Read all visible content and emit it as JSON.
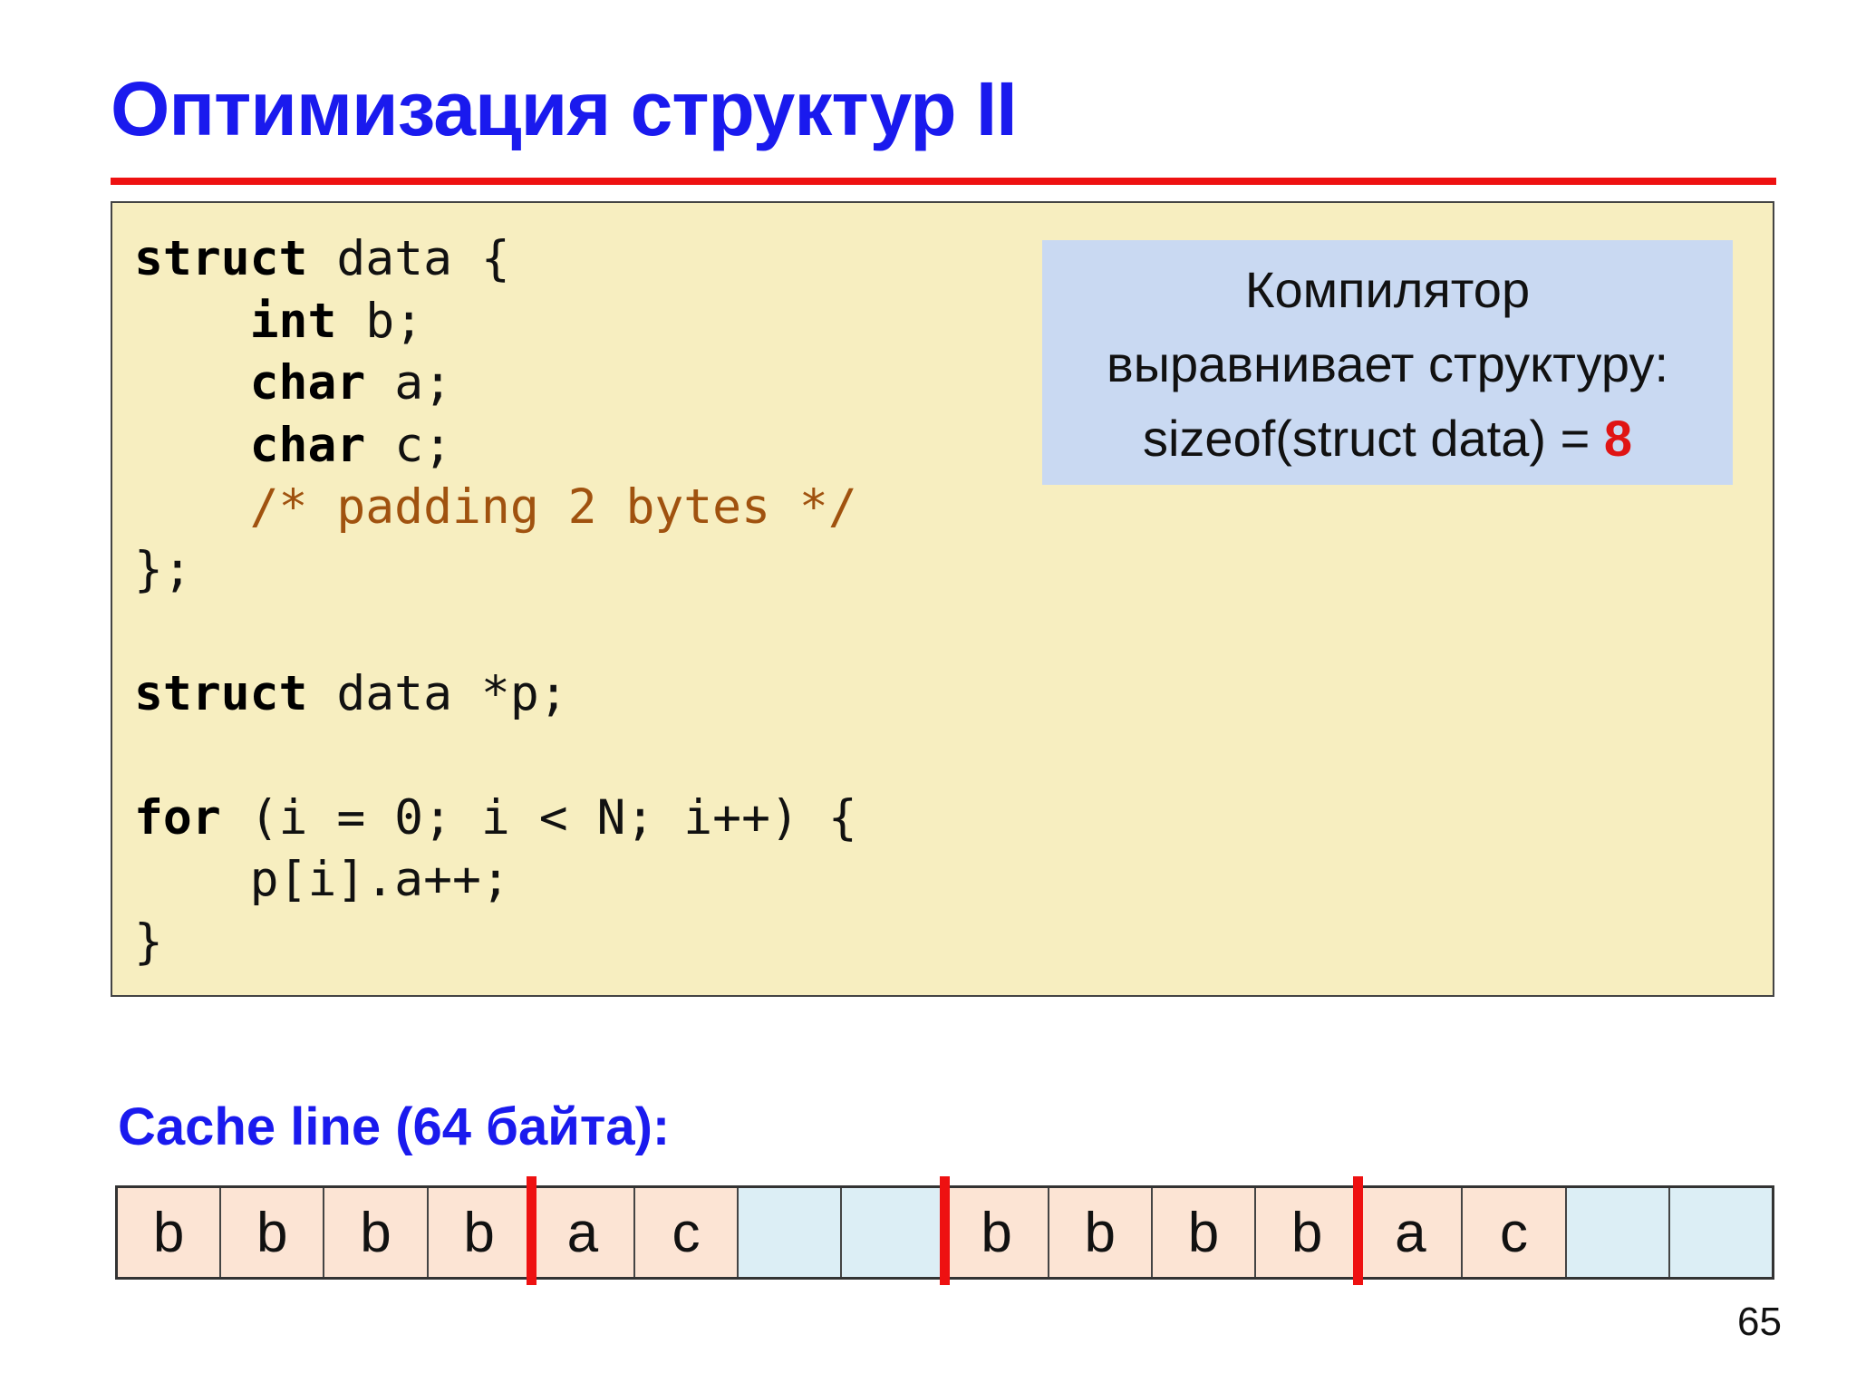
{
  "slide": {
    "title": "Оптимизация структур II",
    "page_number": "65"
  },
  "code": {
    "lines": [
      {
        "kw": "struct",
        "rest": " data {",
        "indent": "",
        "comment": ""
      },
      {
        "kw": "int",
        "rest": " b;",
        "indent": "    ",
        "comment": ""
      },
      {
        "kw": "char",
        "rest": " a;",
        "indent": "    ",
        "comment": ""
      },
      {
        "kw": "char",
        "rest": " c;",
        "indent": "    ",
        "comment": ""
      },
      {
        "kw": "",
        "rest": "",
        "indent": "    ",
        "comment": "/* padding 2 bytes */"
      },
      {
        "kw": "",
        "rest": "};",
        "indent": "",
        "comment": ""
      },
      {
        "kw": "",
        "rest": "",
        "indent": "",
        "comment": ""
      },
      {
        "kw": "struct",
        "rest": " data *p;",
        "indent": "",
        "comment": ""
      },
      {
        "kw": "",
        "rest": "",
        "indent": "",
        "comment": ""
      },
      {
        "kw": "for",
        "rest": " (i = 0; i < N; i++) {",
        "indent": "",
        "comment": ""
      },
      {
        "kw": "",
        "rest": "p[i].a++;",
        "indent": "    ",
        "comment": ""
      },
      {
        "kw": "",
        "rest": "}",
        "indent": "",
        "comment": ""
      }
    ]
  },
  "note": {
    "line1": "Компилятор",
    "line2": "выравнивает структуру:",
    "line3_prefix": "sizeof(struct data) = ",
    "line3_value": "8"
  },
  "cache": {
    "label": "Cache line (64 байта):",
    "cells": [
      "b",
      "b",
      "b",
      "b",
      "a",
      "c",
      "",
      "",
      "b",
      "b",
      "b",
      "b",
      "a",
      "c",
      "",
      ""
    ],
    "boundaries_after_cell": [
      4,
      8,
      12
    ],
    "colors": {
      "data": "#fce4d4",
      "padding": "#dceef5",
      "boundary": "#ee1111"
    }
  }
}
